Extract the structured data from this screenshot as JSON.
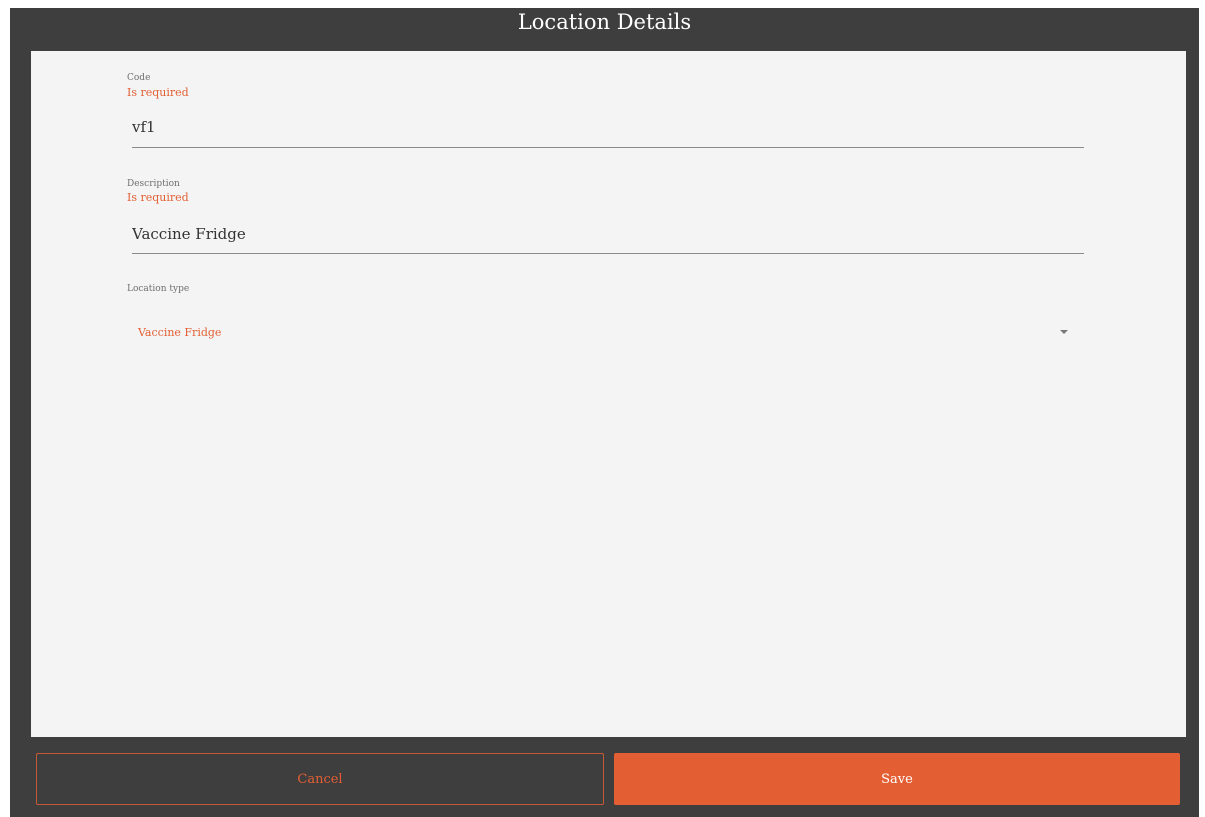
{
  "dialog": {
    "title": "Location Details"
  },
  "form": {
    "code": {
      "label": "Code",
      "error": "Is required",
      "value": "vf1"
    },
    "description": {
      "label": "Description",
      "error": "Is required",
      "value": "Vaccine Fridge"
    },
    "location_type": {
      "label": "Location type",
      "selected": "Vaccine Fridge"
    }
  },
  "actions": {
    "cancel_label": "Cancel",
    "save_label": "Save"
  },
  "colors": {
    "accent": "#e35f33",
    "frame": "#3e3e3e",
    "panel": "#f4f4f4"
  }
}
